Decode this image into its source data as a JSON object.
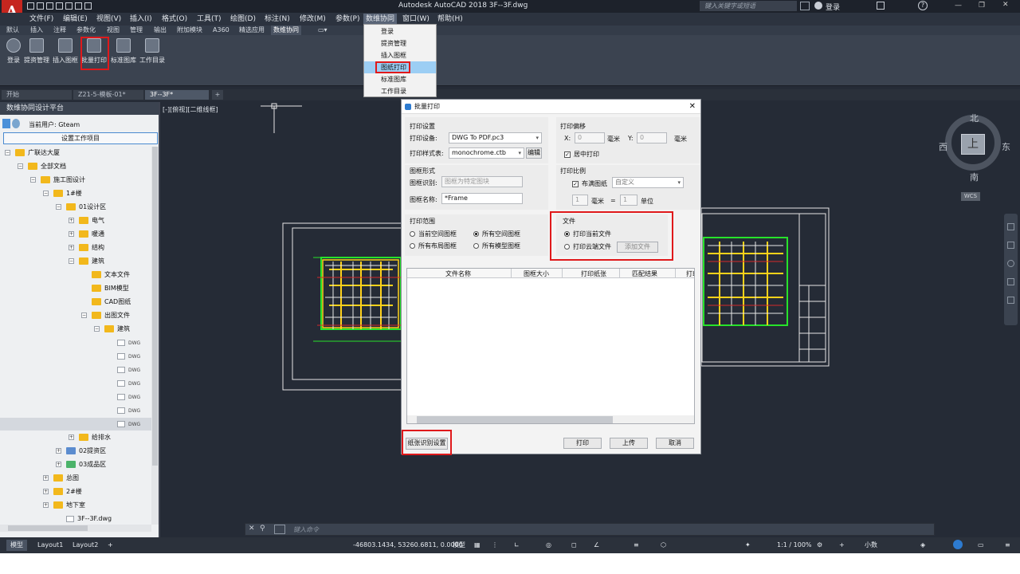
{
  "titlebar": {
    "title": "Autodesk AutoCAD 2018    3F--3F.dwg",
    "search_placeholder": "键入关键字或短语",
    "login": "登录"
  },
  "menu": [
    "文件(F)",
    "编辑(E)",
    "视图(V)",
    "插入(I)",
    "格式(O)",
    "工具(T)",
    "绘图(D)",
    "标注(N)",
    "修改(M)",
    "参数(P)",
    "数维协同",
    "窗口(W)",
    "帮助(H)"
  ],
  "ribbon_tabs": [
    "默认",
    "插入",
    "注释",
    "参数化",
    "视图",
    "管理",
    "输出",
    "附加模块",
    "A360",
    "精选应用",
    "数维协同"
  ],
  "ribbon_buttons": [
    "登录",
    "提资管理",
    "插入图框",
    "批量打印",
    "标准图库",
    "工作目录"
  ],
  "doc_tabs": [
    "开始",
    "Z21-5-模板-01*",
    "3F--3F*"
  ],
  "dropdown": {
    "items": [
      "登录",
      "提资管理",
      "插入图框",
      "图纸打印",
      "标准图库",
      "工作目录"
    ],
    "highlighted": "图纸打印"
  },
  "left_panel": {
    "title": "数维协同设计平台",
    "current_user": "当前用户: Gteam",
    "setup_button": "设置工作项目",
    "tree": [
      {
        "label": "广联达大厦",
        "level": 0,
        "pm": "-",
        "kind": "folder"
      },
      {
        "label": "全部文档",
        "level": 1,
        "pm": "-",
        "kind": "folder"
      },
      {
        "label": "施工图设计",
        "level": 2,
        "pm": "-",
        "kind": "folder"
      },
      {
        "label": "1#楼",
        "level": 3,
        "pm": "-",
        "kind": "folder"
      },
      {
        "label": "01设计区",
        "level": 4,
        "pm": "-",
        "kind": "folder"
      },
      {
        "label": "电气",
        "level": 5,
        "pm": "+",
        "kind": "folder"
      },
      {
        "label": "暖通",
        "level": 5,
        "pm": "+",
        "kind": "folder"
      },
      {
        "label": "结构",
        "level": 5,
        "pm": "+",
        "kind": "folder"
      },
      {
        "label": "建筑",
        "level": 5,
        "pm": "-",
        "kind": "folder"
      },
      {
        "label": "文本文件",
        "level": 6,
        "pm": "",
        "kind": "folder"
      },
      {
        "label": "BIM模型",
        "level": 6,
        "pm": "",
        "kind": "folder"
      },
      {
        "label": "CAD图纸",
        "level": 6,
        "pm": "",
        "kind": "folder"
      },
      {
        "label": "出图文件",
        "level": 6,
        "pm": "-",
        "kind": "folder"
      },
      {
        "label": "建筑",
        "level": 7,
        "pm": "-",
        "kind": "folder"
      },
      {
        "label": "DWG",
        "level": 8,
        "pm": "",
        "kind": "dwg"
      },
      {
        "label": "DWG",
        "level": 8,
        "pm": "",
        "kind": "dwg"
      },
      {
        "label": "DWG",
        "level": 8,
        "pm": "",
        "kind": "dwg"
      },
      {
        "label": "DWG",
        "level": 8,
        "pm": "",
        "kind": "dwg"
      },
      {
        "label": "DWG",
        "level": 8,
        "pm": "",
        "kind": "dwg"
      },
      {
        "label": "DWG",
        "level": 8,
        "pm": "",
        "kind": "dwg"
      },
      {
        "label": "DWG",
        "level": 8,
        "pm": "",
        "kind": "dwg"
      },
      {
        "label": "给排水",
        "level": 5,
        "pm": "+",
        "kind": "folder"
      },
      {
        "label": "02提资区",
        "level": 4,
        "pm": "+",
        "kind": "share"
      },
      {
        "label": "03成品区",
        "level": 4,
        "pm": "+",
        "kind": "check"
      },
      {
        "label": "总图",
        "level": 3,
        "pm": "+",
        "kind": "folder"
      },
      {
        "label": "2#楼",
        "level": 3,
        "pm": "+",
        "kind": "folder"
      },
      {
        "label": "地下室",
        "level": 3,
        "pm": "+",
        "kind": "folder"
      },
      {
        "label": "3F--3F.dwg",
        "level": 4,
        "pm": "",
        "kind": "dwgfile"
      }
    ]
  },
  "viewport_label": "[-][俯视][二维线框]",
  "viewcube": {
    "north": "北",
    "south": "南",
    "east": "东",
    "west": "西",
    "top": "上",
    "wcs": "WCS"
  },
  "dialog": {
    "title": "批量打印",
    "print_settings": {
      "title": "打印设置",
      "device_label": "打印设备:",
      "device_value": "DWG To PDF.pc3",
      "style_label": "打印样式表:",
      "style_value": "monochrome.ctb",
      "edit_button": "编辑"
    },
    "offset": {
      "title": "打印偏移",
      "x_label": "X:",
      "x_value": "0",
      "y_label": "Y:",
      "y_value": "0",
      "unit": "毫米",
      "center_label": "居中打印"
    },
    "frame": {
      "title": "图框形式",
      "id_label": "图框识别:",
      "id_placeholder": "图框为特定图块",
      "name_label": "图框名称:",
      "name_value": "*Frame"
    },
    "scale": {
      "title": "打印比例",
      "fit_label": "布满图纸",
      "scale_value": "自定义",
      "val1": "1",
      "mm": "毫米",
      "eq": "=",
      "val2": "1",
      "unit": "单位"
    },
    "range": {
      "title": "打印范围",
      "options": [
        "当前空间图框",
        "所有空间图框",
        "所有布局图框",
        "所有模型图框"
      ],
      "selected": "所有空间图框"
    },
    "file": {
      "title": "文件",
      "options": [
        "打印当前文件",
        "打印云端文件"
      ],
      "selected": "打印当前文件",
      "add_button": "添加文件"
    },
    "table_headers": [
      "文件名称",
      "图框大小",
      "打印纸张",
      "匹配结果",
      "打印"
    ],
    "paper_button": "纸张识别设置",
    "print_button": "打印",
    "upload_button": "上传",
    "cancel_button": "取消"
  },
  "command_placeholder": "键入命令",
  "layout_tabs": [
    "模型",
    "Layout1",
    "Layout2"
  ],
  "status": {
    "coords": "-46803.1434, 53260.6811, 0.0000",
    "model": "模型",
    "scale": "1:1 / 100%",
    "units": "小数"
  }
}
